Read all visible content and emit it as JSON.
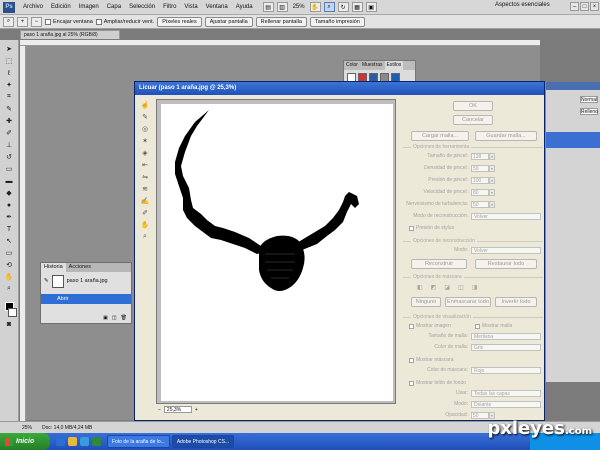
{
  "menubar": {
    "logo": "Ps",
    "items": [
      "Archivo",
      "Edición",
      "Imagen",
      "Capa",
      "Selección",
      "Filtro",
      "Vista",
      "Ventana",
      "Ayuda"
    ],
    "zoom": "25%",
    "workspace": "Aspectos esenciales"
  },
  "options_bar": {
    "resize_windows": "Encajar ventana",
    "zoom_all": "Ampliar/reducir vent.",
    "buttons": [
      "Píxeles reales",
      "Ajustar pantalla",
      "Rellenar pantalla",
      "Tamaño impresión"
    ]
  },
  "document": {
    "tab": "paso 1 araña.jpg al 25% (RGB/8)"
  },
  "swatch_panel": {
    "tabs": [
      "Color",
      "Muestras",
      "Estilos"
    ],
    "colors": [
      "#ffffff",
      "#d23434",
      "#2d5b9c",
      "#8a8a8a",
      "#1f5fb0"
    ]
  },
  "layers_panel": {
    "field1": "Normal",
    "field2": "Relleno"
  },
  "history": {
    "tabs": [
      "Historia",
      "Acciones"
    ],
    "snapshot": "paso 1 araña.jpg",
    "step": "Abrir"
  },
  "liquify": {
    "title": "Licuar (paso 1 araña.jpg @ 25,3%)",
    "zoom": "25,3%",
    "ok": "OK",
    "cancel": "Cancelar",
    "load_mesh": "Cargar malla...",
    "save_mesh": "Guardar malla...",
    "tool_options": "Opciones de herramienta",
    "brush_size_label": "Tamaño de pincel:",
    "brush_size": "138",
    "brush_density_label": "Densidad de pincel:",
    "brush_density": "50",
    "brush_pressure_label": "Presión de pincel:",
    "brush_pressure": "100",
    "brush_rate_label": "Velocidad de pincel:",
    "brush_rate": "80",
    "turbulent_jitter_label": "Nerviosismo de turbulencia:",
    "turbulent_jitter": "50",
    "reconstruct_mode_label": "Modo de reconstrucción:",
    "reconstruct_mode": "Volver",
    "stylus_pressure": "Presión de stylus",
    "reconstruct_options": "Opciones de reconstrucción",
    "mode_label": "Modo:",
    "mode": "Volver",
    "reconstruct": "Reconstruir",
    "restore_all": "Restaurar todo",
    "mask_options": "Opciones de máscara",
    "none": "Ninguno",
    "mask_all": "Enmascarar todo",
    "invert_all": "Invertir todo",
    "view_options": "Opciones de visualización",
    "show_image": "Mostrar imagen",
    "show_mesh": "Mostrar malla",
    "mesh_size_label": "Tamaño de malla:",
    "mesh_size": "Mediana",
    "mesh_color_label": "Color de malla:",
    "mesh_color": "Gris",
    "show_mask": "Mostrar máscara",
    "mask_color_label": "Color de máscara:",
    "mask_color": "Rojo",
    "show_backdrop": "Mostrar telón de fondo",
    "use_label": "Usar:",
    "use": "Todas las capas",
    "backdrop_mode_label": "Modo:",
    "backdrop_mode": "Delante",
    "opacity_label": "Opacidad:",
    "opacity": "50"
  },
  "statusbar": {
    "zoom": "25%",
    "doc": "Doc: 14,0 MB/4,24 MB"
  },
  "taskbar": {
    "start": "Inicio",
    "tasks": [
      "Foto de la araña de lo...",
      "Adobe Photoshop CS..."
    ]
  },
  "watermark": {
    "brand": "pxleyes",
    "tld": ".com"
  }
}
